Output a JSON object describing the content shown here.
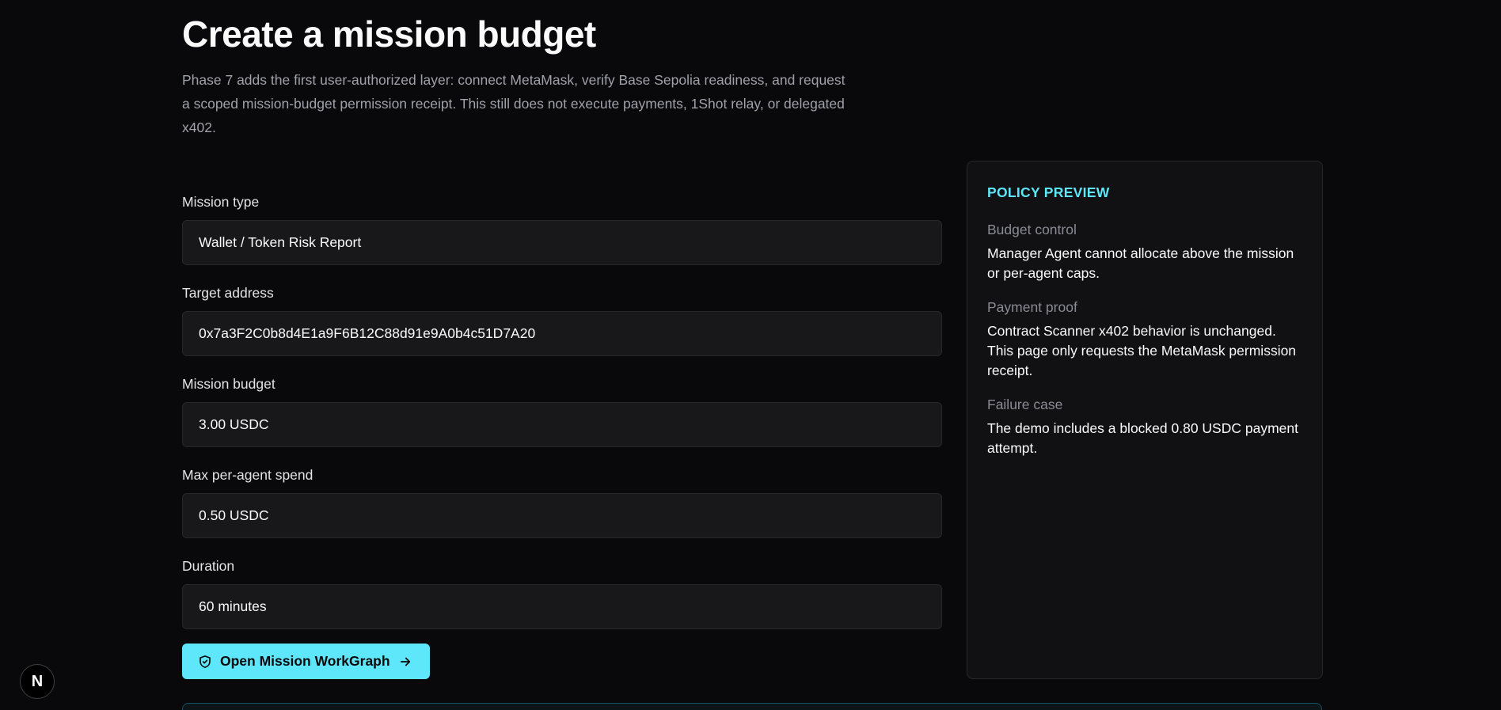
{
  "header": {
    "title": "Create a mission budget",
    "description": "Phase 7 adds the first user-authorized layer: connect MetaMask, verify Base Sepolia readiness, and request a scoped mission-budget permission receipt. This still does not execute payments, 1Shot relay, or delegated x402."
  },
  "form": {
    "mission_type": {
      "label": "Mission type",
      "value": "Wallet / Token Risk Report"
    },
    "target_address": {
      "label": "Target address",
      "value": "0x7a3F2C0b8d4E1a9F6B12C88d91e9A0b4c51D7A20"
    },
    "mission_budget": {
      "label": "Mission budget",
      "value": "3.00 USDC"
    },
    "max_per_agent": {
      "label": "Max per-agent spend",
      "value": "0.50 USDC"
    },
    "duration": {
      "label": "Duration",
      "value": "60 minutes"
    },
    "submit_label": "Open Mission WorkGraph"
  },
  "policy": {
    "heading": "POLICY PREVIEW",
    "items": [
      {
        "title": "Budget control",
        "text": "Manager Agent cannot allocate above the mission or per-agent caps."
      },
      {
        "title": "Payment proof",
        "text": "Contract Scanner x402 behavior is unchanged. This page only requests the MetaMask permission receipt."
      },
      {
        "title": "Failure case",
        "text": "The demo includes a blocked 0.80 USDC payment attempt."
      }
    ]
  },
  "badge": {
    "letter": "N"
  },
  "icons": {
    "submit_leading": "shield-check-icon",
    "submit_trailing": "arrow-right-icon"
  },
  "colors": {
    "background": "#09090b",
    "accent": "#5ee6fb",
    "input_bg": "#18181b",
    "panel_bg": "#111113"
  }
}
